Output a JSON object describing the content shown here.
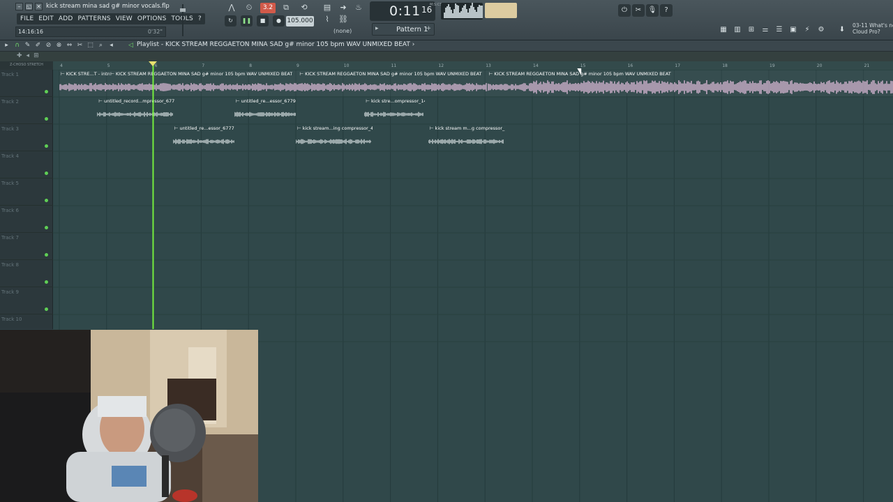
{
  "window": {
    "filename": "kick stream mina sad g# minor vocals.flp",
    "buttons": [
      "–",
      "◱",
      "✕"
    ]
  },
  "menu": [
    "FILE",
    "EDIT",
    "ADD",
    "PATTERNS",
    "VIEW",
    "OPTIONS",
    "TOOLS",
    "?"
  ],
  "hint": {
    "time": "14:16:16",
    "length": "0'32\""
  },
  "transport": {
    "time_digits": "0:11",
    "time_ms": "16",
    "time_unit": "M:S:CS",
    "bpm_tag": "3.2",
    "tempo": "105.000",
    "pattern_none": "(none)",
    "pattern": "Pattern 1"
  },
  "news": {
    "line1": "03-11  What's new",
    "line2": "Cloud Pro?"
  },
  "playlist": {
    "title": "Playlist - KICK STREAM REGGAETON MINA SAD g# minor 105 bpm WAV UNMIXED BEAT",
    "arrow": "›",
    "ruler_numbers": [
      "4",
      "5",
      "6",
      "7",
      "8",
      "9",
      "10",
      "11",
      "12",
      "13",
      "14",
      "15",
      "16",
      "17",
      "18",
      "19",
      "20",
      "21"
    ],
    "mini_labels": "Z-CHOSO  STRETCH"
  },
  "tracks": [
    {
      "label": "Track 1"
    },
    {
      "label": "Track 2"
    },
    {
      "label": "Track 3"
    },
    {
      "label": "Track 4"
    },
    {
      "label": "Track 5"
    },
    {
      "label": "Track 6"
    },
    {
      "label": "Track 7"
    },
    {
      "label": "Track 8"
    },
    {
      "label": "Track 9"
    },
    {
      "label": "Track 10"
    }
  ],
  "clips": [
    {
      "track": 0,
      "title": "⊢ KICK STRE...T - intro",
      "start": 0.0,
      "end": 1.05,
      "kind": "main"
    },
    {
      "track": 0,
      "title": "⊢ KICK STREAM REGGAETON MINA SAD g# minor 105 bpm WAV UNMIXED BEAT",
      "start": 1.05,
      "end": 5.05,
      "kind": "main"
    },
    {
      "track": 0,
      "title": "⊢ KICK STREAM REGGAETON MINA SAD g# minor 105 bpm WAV UNMIXED BEAT",
      "start": 5.05,
      "end": 9.05,
      "kind": "main"
    },
    {
      "track": 0,
      "title": "⊢ KICK STREAM REGGAETON MINA SAD g# minor 105 bpm WAV UNMIXED BEAT",
      "start": 9.05,
      "end": 17.7,
      "kind": "main"
    },
    {
      "track": 1,
      "title": "⊢ untitled_record...mpressor_6775",
      "start": 0.8,
      "end": 2.4,
      "kind": "vocal"
    },
    {
      "track": 1,
      "title": "⊢ untitled_re...essor_6779",
      "start": 3.7,
      "end": 5.0,
      "kind": "vocal"
    },
    {
      "track": 1,
      "title": "⊢ kick stre...ompressor_14",
      "start": 6.45,
      "end": 7.7,
      "kind": "vocal"
    },
    {
      "track": 2,
      "title": "⊢ untitled_re...essor_6777",
      "start": 2.4,
      "end": 3.7,
      "kind": "vocal"
    },
    {
      "track": 2,
      "title": "⊢ kick stream...ing compressor_4",
      "start": 5.0,
      "end": 6.6,
      "kind": "vocal"
    },
    {
      "track": 2,
      "title": "⊢ kick stream m...g compressor_17",
      "start": 7.8,
      "end": 9.4,
      "kind": "vocal"
    }
  ],
  "playhead_bar": 5.97,
  "colors": {
    "grid_bg": "#30484a",
    "main_wave": "#d8b8d4",
    "vocal_wave": "#c9d2d4",
    "playhead": "#7dff3c",
    "track_dot": "#5fcf55"
  }
}
